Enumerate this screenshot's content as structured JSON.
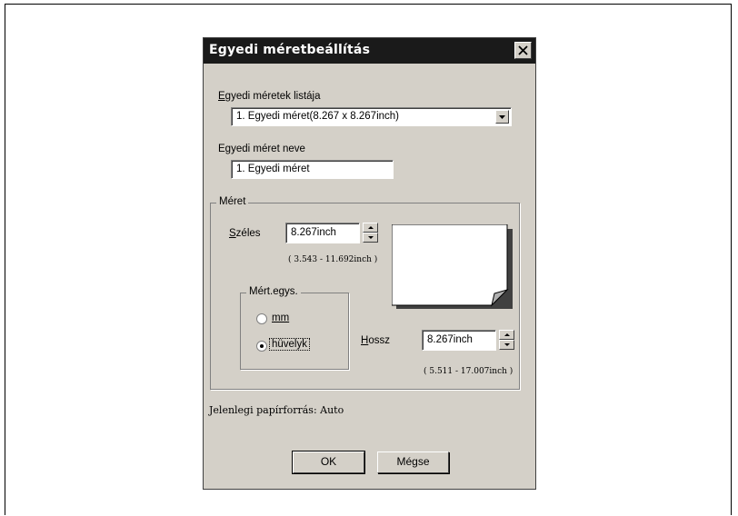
{
  "dialog": {
    "title": "Egyedi méretbeállítás"
  },
  "custom_sizes_list": {
    "label_ul": "E",
    "label_rest": "gyedi méretek listája",
    "selected": "1. Egyedi méret(8.267 x 8.267inch)"
  },
  "custom_size_name": {
    "label_pre": "E",
    "label_ul": "g",
    "label_rest": "yedi méret neve",
    "value": "1. Egyedi méret"
  },
  "size_group": {
    "title": "Méret",
    "width": {
      "label_ul": "S",
      "label_rest": "zéles",
      "value": "8.267inch",
      "range": "( 3.543 - 11.692inch )"
    },
    "length": {
      "label_ul": "H",
      "label_rest": "ossz",
      "value": "8.267inch",
      "range": "( 5.511 - 17.007inch )"
    },
    "units": {
      "title": "Mért.egys.",
      "mm_label": "mm",
      "inch_label": "hüvelyk",
      "selected": "hüvelyk"
    }
  },
  "paper_source": "Jelenlegi papírforrás: Auto",
  "buttons": {
    "ok": "OK",
    "cancel": "Mégse"
  },
  "icons": {
    "close": "close-icon",
    "dropdown": "chevron-down-icon",
    "spin_up": "spin-up-icon",
    "spin_down": "spin-down-icon",
    "paper": "paper-preview-icon"
  }
}
